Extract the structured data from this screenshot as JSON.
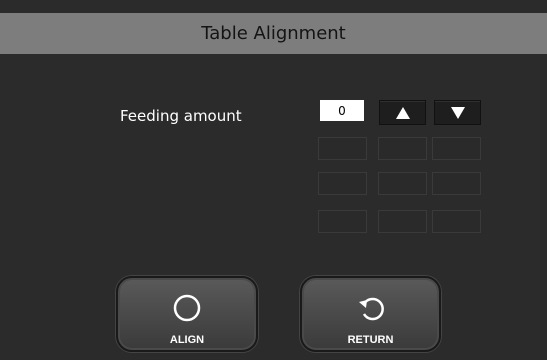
{
  "title": "Table Alignment",
  "feeding": {
    "label": "Feeding amount",
    "value": "0"
  },
  "buttons": {
    "up_icon": "triangle-up-icon",
    "down_icon": "triangle-down-icon",
    "align_label": "ALIGN",
    "align_icon": "circle-icon",
    "return_label": "RETURN",
    "return_icon": "undo-arrow-icon"
  },
  "colors": {
    "background": "#2b2b2b",
    "title_bar": "#7d7d7d"
  }
}
